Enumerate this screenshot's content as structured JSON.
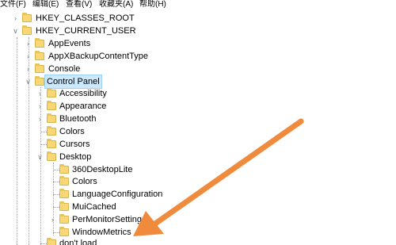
{
  "menu": {
    "file": "文件(F)",
    "edit": "编辑(E)",
    "view": "查看(V)",
    "favorites": "收藏夹(A)",
    "help": "帮助(H)"
  },
  "tree": {
    "hkcr": "HKEY_CLASSES_ROOT",
    "hkcu": "HKEY_CURRENT_USER",
    "app_events": "AppEvents",
    "appx": "AppXBackupContentType",
    "console": "Console",
    "control_panel": "Control Panel",
    "accessibility": "Accessibility",
    "appearance": "Appearance",
    "bluetooth": "Bluetooth",
    "colors": "Colors",
    "cursors": "Cursors",
    "desktop": "Desktop",
    "desktop_lite": "360DesktopLite",
    "desktop_colors": "Colors",
    "language_config": "LanguageConfiguration",
    "mui_cached": "MuiCached",
    "per_monitor": "PerMonitorSettings",
    "window_metrics": "WindowMetrics",
    "dont_load": "don't load"
  },
  "colors": {
    "arrow": "#f08a3c",
    "selection": "#cce8ff",
    "folder": "#f8d775"
  }
}
